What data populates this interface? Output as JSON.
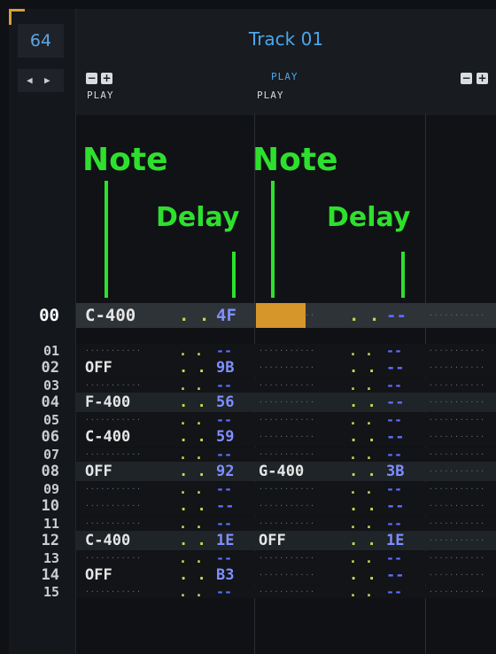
{
  "lines_per_pattern": "64",
  "nav": {
    "left": "◀",
    "right": "▶"
  },
  "track": {
    "title": "Track 01"
  },
  "header": {
    "col1_minus": "−",
    "col1_plus": "+",
    "col1_label": "PLAY",
    "mid_top_label": "PLAY",
    "col2_label": "PLAY",
    "col3_minus": "−",
    "col3_plus": "+"
  },
  "annotations": {
    "note1": "Note",
    "delay1": "Delay",
    "note2": "Note",
    "delay2": "Delay"
  },
  "empty_note": "···········",
  "empty_delay": "−−",
  "rows": [
    {
      "n": "00",
      "c1": "C-400",
      "d1": "4F",
      "c2": "",
      "d2": "--"
    },
    {
      "n": "01",
      "c1": "",
      "d1": "--",
      "c2": "",
      "d2": "--"
    },
    {
      "n": "02",
      "c1": "OFF",
      "d1": "9B",
      "c2": "",
      "d2": "--"
    },
    {
      "n": "03",
      "c1": "",
      "d1": "--",
      "c2": "",
      "d2": "--"
    },
    {
      "n": "04",
      "c1": "F-400",
      "d1": "56",
      "c2": "",
      "d2": "--"
    },
    {
      "n": "05",
      "c1": "",
      "d1": "--",
      "c2": "",
      "d2": "--"
    },
    {
      "n": "06",
      "c1": "C-400",
      "d1": "59",
      "c2": "",
      "d2": "--"
    },
    {
      "n": "07",
      "c1": "",
      "d1": "--",
      "c2": "",
      "d2": "--"
    },
    {
      "n": "08",
      "c1": "OFF",
      "d1": "92",
      "c2": "G-400",
      "d2": "3B"
    },
    {
      "n": "09",
      "c1": "",
      "d1": "--",
      "c2": "",
      "d2": "--"
    },
    {
      "n": "10",
      "c1": "",
      "d1": "--",
      "c2": "",
      "d2": "--"
    },
    {
      "n": "11",
      "c1": "",
      "d1": "--",
      "c2": "",
      "d2": "--"
    },
    {
      "n": "12",
      "c1": "C-400",
      "d1": "1E",
      "c2": "OFF",
      "d2": "1E"
    },
    {
      "n": "13",
      "c1": "",
      "d1": "--",
      "c2": "",
      "d2": "--"
    },
    {
      "n": "14",
      "c1": "OFF",
      "d1": "B3",
      "c2": "",
      "d2": "--"
    },
    {
      "n": "15",
      "c1": "",
      "d1": "--",
      "c2": "",
      "d2": "--"
    }
  ]
}
